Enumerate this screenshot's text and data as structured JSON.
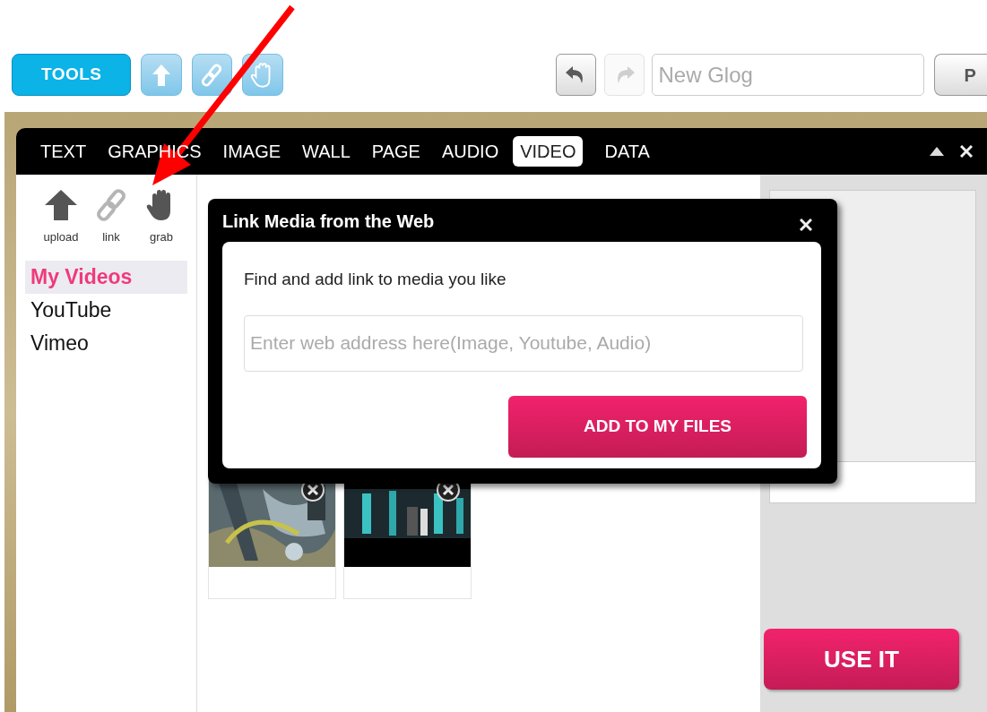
{
  "toolbar": {
    "tools_button": "TOOLS",
    "undo": {
      "disabled": false
    },
    "redo": {
      "disabled": true
    },
    "title_field": {
      "placeholder": "New Glog"
    },
    "cut_button": "P"
  },
  "tabs": [
    {
      "label": "TEXT",
      "selected": false
    },
    {
      "label": "GRAPHICS",
      "selected": false
    },
    {
      "label": "IMAGE",
      "selected": false
    },
    {
      "label": "WALL",
      "selected": false
    },
    {
      "label": "PAGE",
      "selected": false
    },
    {
      "label": "AUDIO",
      "selected": false
    },
    {
      "label": "VIDEO",
      "selected": true
    },
    {
      "label": "DATA",
      "selected": false
    }
  ],
  "sidebar": {
    "tools": [
      {
        "kind": "upload",
        "label": "upload",
        "disabled": false
      },
      {
        "kind": "link",
        "label": "link",
        "disabled": true
      },
      {
        "kind": "grab",
        "label": "grab",
        "disabled": false
      }
    ],
    "sources": [
      {
        "label": "My Videos",
        "selected": true
      },
      {
        "label": "YouTube",
        "selected": false
      },
      {
        "label": "Vimeo",
        "selected": false
      }
    ]
  },
  "dialog": {
    "title": "Link Media from the Web",
    "prompt": "Find and add link to media you like",
    "url_field": {
      "placeholder": "Enter web address here(Image, Youtube, Audio)"
    },
    "button": "ADD TO MY FILES"
  },
  "use_button": "USE IT"
}
